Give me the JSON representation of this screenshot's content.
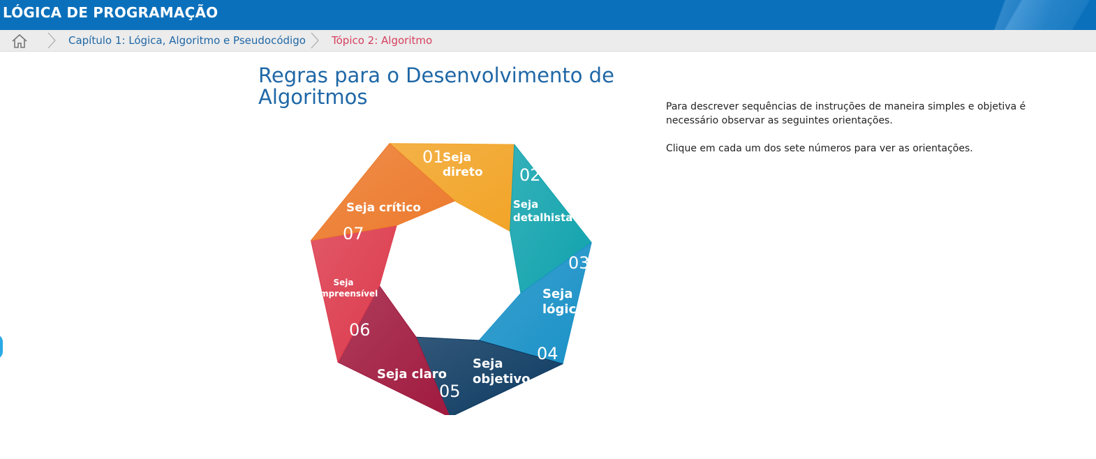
{
  "header": {
    "title": "LÓGICA DE PROGRAMAÇÃO"
  },
  "breadcrumb": {
    "home_icon": "home-icon",
    "separator_icon": "chevron-right-icon",
    "items": [
      {
        "label": "Capítulo 1: Lógica, Algoritmo e Pseudocódigo",
        "color": "#1f67a6"
      },
      {
        "label": "Tópico 2: Algoritmo",
        "color": "#d6405f"
      }
    ]
  },
  "main": {
    "title": "Regras para o Desenvolvimento de Algoritmos",
    "intro": [
      "Para descrever sequências de instruções de maneira simples e objetiva é necessário observar as seguintes orientações.",
      "Clique em cada um dos sete números para ver as orientações."
    ]
  },
  "wheel": {
    "segments": [
      {
        "number": "01",
        "label_lines": [
          "Seja",
          "direto"
        ],
        "color": "#f2a427"
      },
      {
        "number": "02",
        "label_lines": [
          "Seja",
          "detalhista"
        ],
        "color": "#11a3ad"
      },
      {
        "number": "03",
        "label_lines": [
          "Seja",
          "lógico"
        ],
        "color": "#1a91c7"
      },
      {
        "number": "04",
        "label_lines": [
          "Seja",
          "objetivo"
        ],
        "color": "#0d3a61"
      },
      {
        "number": "05",
        "label_lines": [
          "Seja claro"
        ],
        "color": "#a01a3e"
      },
      {
        "number": "06",
        "label_lines": [
          "Seja",
          "compreensível"
        ],
        "color": "#dc3a4c"
      },
      {
        "number": "07",
        "label_lines": [
          "Seja crítico"
        ],
        "color": "#ec7a2c"
      }
    ]
  },
  "side_handle": {
    "color": "#2ba9e6"
  }
}
